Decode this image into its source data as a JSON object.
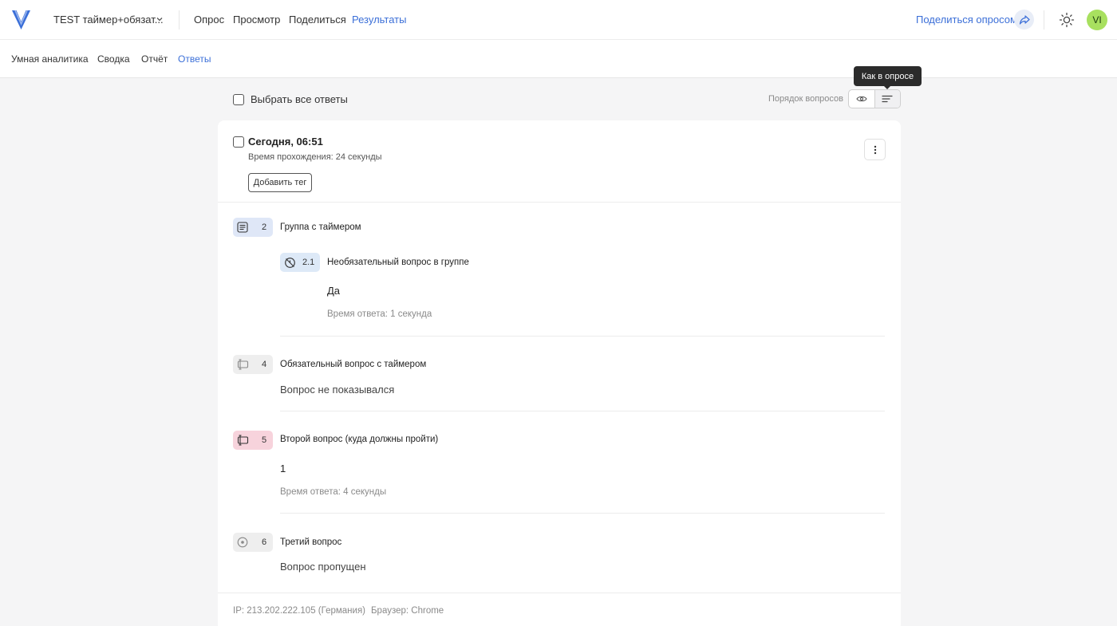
{
  "header": {
    "survey_title": "TEST таймер+обязат...",
    "nav": [
      "Опрос",
      "Просмотр",
      "Поделиться",
      "Результаты"
    ],
    "active_nav": "Результаты",
    "share_label": "Поделиться опросом",
    "avatar_initials": "VI"
  },
  "subnav": {
    "tabs": [
      "Умная аналитика",
      "Сводка",
      "Отчёт",
      "Ответы"
    ],
    "active_tab": "Ответы"
  },
  "toolbar": {
    "select_all_label": "Выбрать все ответы",
    "order_label": "Порядок вопросов",
    "tooltip": "Как в опросе"
  },
  "response": {
    "date": "Сегодня, 06:51",
    "duration": "Время прохождения: 24 секунды",
    "add_tag_label": "Добавить тег",
    "questions": [
      {
        "number": "2",
        "title": "Группа с таймером",
        "icon": "list-icon",
        "badge_color": "#dfe7f7"
      },
      {
        "number": "2.1",
        "title": "Необязательный вопрос в группе",
        "icon": "no-timer-icon",
        "badge_color": "#dde9f7",
        "answer": "Да",
        "answer_time": "Время ответа: 1 секунда"
      },
      {
        "number": "4",
        "title": "Обязательный вопрос с таймером",
        "icon": "text-cursor-icon",
        "badge_color": "#eeeeee",
        "answer": "Вопрос не показывался"
      },
      {
        "number": "5",
        "title": "Второй вопрос (куда должны пройти)",
        "icon": "text-cursor-icon",
        "badge_color": "#f7d3dc",
        "answer": "1",
        "answer_time": "Время ответа: 4 секунды"
      },
      {
        "number": "6",
        "title": "Третий вопрос",
        "icon": "radio-icon",
        "badge_color": "#eeeeee",
        "answer": "Вопрос пропущен"
      }
    ],
    "ip": "IP: 213.202.222.105 (Германия)",
    "browser": "Браузер: Chrome"
  },
  "colors": {
    "accent": "#3b6fd8",
    "avatar": "#a8e05f"
  }
}
